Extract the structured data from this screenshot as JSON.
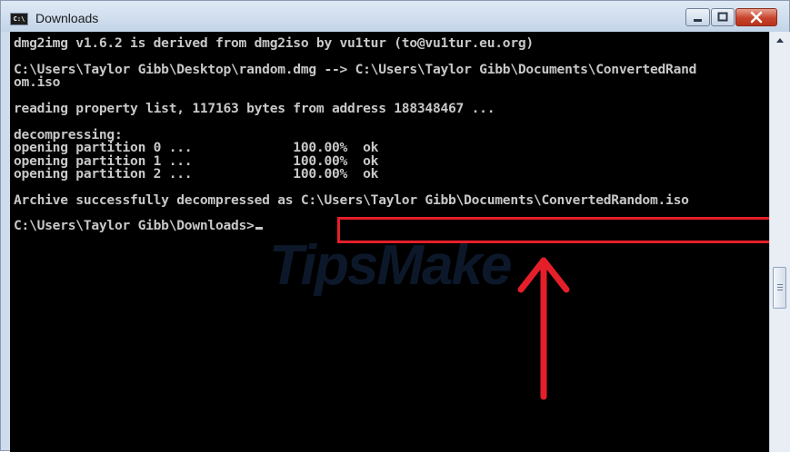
{
  "window": {
    "title": "Downloads",
    "icon_label": "C:\\",
    "controls": [
      "minimize-icon",
      "maximize-icon",
      "close-icon"
    ]
  },
  "console": {
    "lines": [
      "dmg2img v1.6.2 is derived from dmg2iso by vu1tur (to@vu1tur.eu.org)",
      "",
      "C:\\Users\\Taylor Gibb\\Desktop\\random.dmg --> C:\\Users\\Taylor Gibb\\Documents\\ConvertedRand",
      "om.iso",
      "",
      "reading property list, 117163 bytes from address 188348467 ...",
      "",
      "decompressing:",
      "opening partition 0 ...             100.00%  ok",
      "opening partition 1 ...             100.00%  ok",
      "opening partition 2 ...             100.00%  ok",
      "",
      "Archive successfully decompressed as C:\\Users\\Taylor Gibb\\Documents\\ConvertedRandom.iso",
      "",
      "C:\\Users\\Taylor Gibb\\Downloads>"
    ]
  },
  "annotation": {
    "highlight_color": "#e41f2a",
    "arrow_color": "#e41f2a"
  },
  "watermark": "TipsMake"
}
